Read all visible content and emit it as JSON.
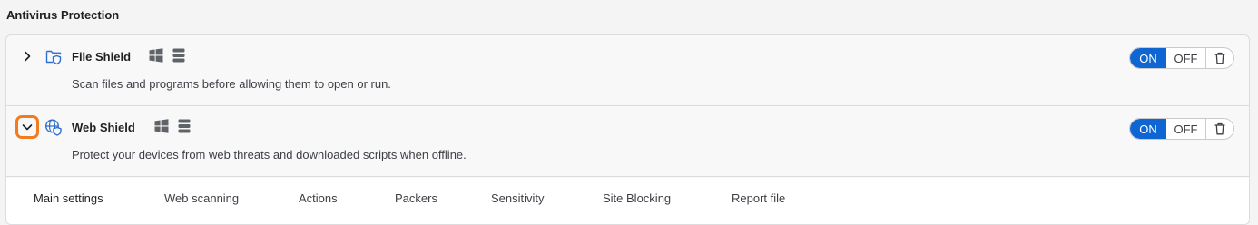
{
  "section": {
    "title": "Antivirus Protection"
  },
  "shields": [
    {
      "name": "File Shield",
      "description": "Scan files and programs before allowing them to open or run.",
      "expanded": false,
      "toggle": {
        "on_label": "ON",
        "off_label": "OFF",
        "state": "on"
      }
    },
    {
      "name": "Web Shield",
      "description": "Protect your devices from web threats and downloaded scripts when offline.",
      "expanded": true,
      "toggle": {
        "on_label": "ON",
        "off_label": "OFF",
        "state": "on"
      }
    }
  ],
  "tabs": [
    {
      "label": "Main settings",
      "active": true
    },
    {
      "label": "Web scanning",
      "active": false
    },
    {
      "label": "Actions",
      "active": false
    },
    {
      "label": "Packers",
      "active": false
    },
    {
      "label": "Sensitivity",
      "active": false
    },
    {
      "label": "Site Blocking",
      "active": false
    },
    {
      "label": "Report file",
      "active": false
    }
  ],
  "colors": {
    "accent": "#0f66d3",
    "focus_ring": "#f47a1f",
    "icon_blue": "#2f6fcf",
    "icon_gray": "#5f6368"
  },
  "icons": {
    "file_shield": "file-shield-icon",
    "web_shield": "globe-shield-icon",
    "windows": "windows-icon",
    "server": "server-icon",
    "delete": "trash-icon",
    "expand": "chevron-right-icon",
    "collapse": "chevron-down-icon"
  }
}
